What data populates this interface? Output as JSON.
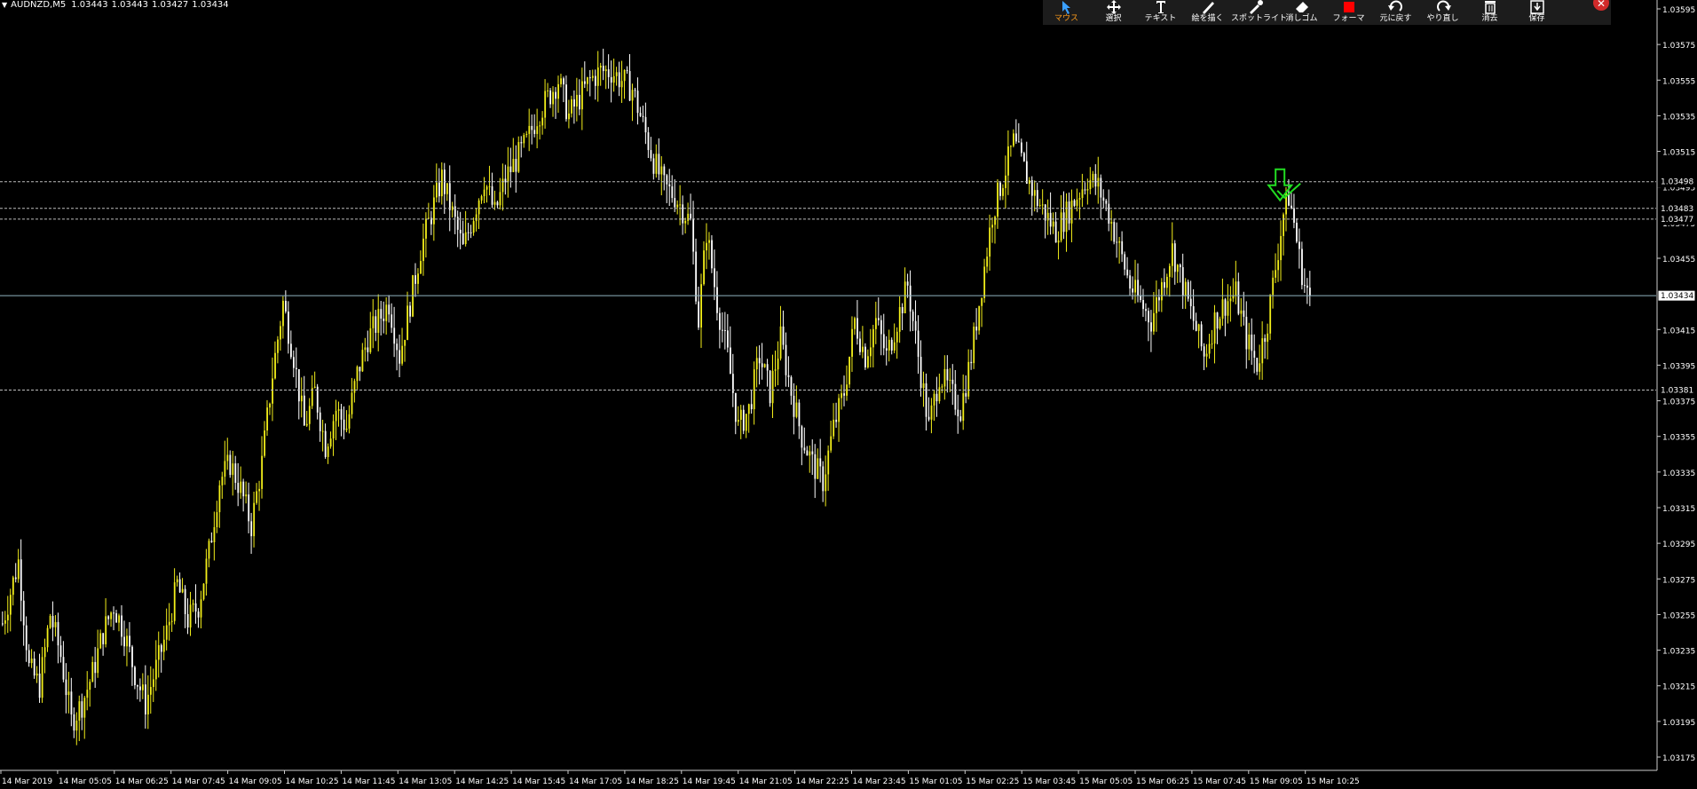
{
  "symbol": {
    "name": "AUDNZD,M5",
    "open": "1.03443",
    "high": "1.03443",
    "low": "1.03427",
    "close": "1.03434"
  },
  "toolbar": {
    "items": [
      {
        "label": "マウス",
        "icon": "cursor-icon",
        "active": true
      },
      {
        "label": "選択",
        "icon": "move-icon",
        "active": false
      },
      {
        "label": "テキスト",
        "icon": "text-icon",
        "active": false
      },
      {
        "label": "絵を描く",
        "icon": "pen-icon",
        "active": false
      },
      {
        "label": "スポットライト",
        "icon": "spotlight-icon",
        "active": false
      },
      {
        "label": "消しゴム",
        "icon": "eraser-icon",
        "active": false
      },
      {
        "label": "フォーマ",
        "icon": "color-swatch-icon",
        "active": false
      },
      {
        "label": "元に戻す",
        "icon": "undo-icon",
        "active": false
      },
      {
        "label": "やり直し",
        "icon": "redo-icon",
        "active": false
      },
      {
        "label": "消去",
        "icon": "trash-icon",
        "active": false
      },
      {
        "label": "保存",
        "icon": "save-icon",
        "active": false
      }
    ],
    "close_icon": "close-icon",
    "swatch_color": "#ff0000"
  },
  "colors": {
    "background": "#000000",
    "bull_candle": "#f2ee1a",
    "bear_candle": "#ffffff",
    "grid_line": "#bbbbbb",
    "bid_line": "#8fb3c0",
    "annotation": "#22dd22"
  },
  "chart_data": {
    "type": "candlestick",
    "y_tick_labels": [
      "1.03595",
      "1.03575",
      "1.03555",
      "1.03535",
      "1.03515",
      "1.03495",
      "1.03475",
      "1.03455",
      "1.03435",
      "1.03415",
      "1.03395",
      "1.03375",
      "1.03355",
      "1.03335",
      "1.03315",
      "1.03295",
      "1.03275",
      "1.03255",
      "1.03235",
      "1.03215",
      "1.03195",
      "1.03175"
    ],
    "x_tick_labels": [
      "14 Mar 2019",
      "14 Mar 05:05",
      "14 Mar 06:25",
      "14 Mar 07:45",
      "14 Mar 09:05",
      "14 Mar 10:25",
      "14 Mar 11:45",
      "14 Mar 13:05",
      "14 Mar 14:25",
      "14 Mar 15:45",
      "14 Mar 17:05",
      "14 Mar 18:25",
      "14 Mar 19:45",
      "14 Mar 21:05",
      "14 Mar 22:25",
      "14 Mar 23:45",
      "15 Mar 01:05",
      "15 Mar 02:25",
      "15 Mar 03:45",
      "15 Mar 05:05",
      "15 Mar 06:25",
      "15 Mar 07:45",
      "15 Mar 09:05",
      "15 Mar 10:25"
    ],
    "ylim": [
      1.0317,
      1.036
    ],
    "bid_price": 1.03434,
    "price_levels": [
      {
        "label": "1.03498",
        "value": 1.03498
      },
      {
        "label": "1.03483",
        "value": 1.03483
      },
      {
        "label": "1.03477",
        "value": 1.03477
      },
      {
        "label": "1.03381",
        "value": 1.03381
      }
    ],
    "bid_label": "1.03434",
    "close_path": [
      [
        0,
        1.0325
      ],
      [
        6,
        1.03285
      ],
      [
        10,
        1.03225
      ],
      [
        14,
        1.03215
      ],
      [
        18,
        1.03255
      ],
      [
        22,
        1.03232
      ],
      [
        26,
        1.03195
      ],
      [
        30,
        1.03205
      ],
      [
        34,
        1.03222
      ],
      [
        38,
        1.03245
      ],
      [
        42,
        1.0326
      ],
      [
        46,
        1.03245
      ],
      [
        50,
        1.03222
      ],
      [
        54,
        1.03205
      ],
      [
        58,
        1.03225
      ],
      [
        62,
        1.03245
      ],
      [
        66,
        1.03272
      ],
      [
        70,
        1.03252
      ],
      [
        74,
        1.0326
      ],
      [
        78,
        1.0329
      ],
      [
        82,
        1.0333
      ],
      [
        86,
        1.0334
      ],
      [
        90,
        1.03325
      ],
      [
        94,
        1.03305
      ],
      [
        98,
        1.0334
      ],
      [
        102,
        1.0339
      ],
      [
        106,
        1.0343
      ],
      [
        110,
        1.034
      ],
      [
        114,
        1.0336
      ],
      [
        118,
        1.0338
      ],
      [
        122,
        1.0335
      ],
      [
        126,
        1.0337
      ],
      [
        130,
        1.0336
      ],
      [
        134,
        1.0339
      ],
      [
        138,
        1.0341
      ],
      [
        142,
        1.0342
      ],
      [
        146,
        1.0343
      ],
      [
        150,
        1.034
      ],
      [
        154,
        1.0343
      ],
      [
        158,
        1.0346
      ],
      [
        162,
        1.0348
      ],
      [
        166,
        1.035
      ],
      [
        170,
        1.0348
      ],
      [
        174,
        1.0346
      ],
      [
        178,
        1.0348
      ],
      [
        182,
        1.035
      ],
      [
        186,
        1.0348
      ],
      [
        190,
        1.035
      ],
      [
        194,
        1.0351
      ],
      [
        198,
        1.0352
      ],
      [
        202,
        1.03535
      ],
      [
        206,
        1.03545
      ],
      [
        210,
        1.03555
      ],
      [
        214,
        1.03535
      ],
      [
        218,
        1.03545
      ],
      [
        222,
        1.03555
      ],
      [
        226,
        1.0356
      ],
      [
        230,
        1.0356
      ],
      [
        234,
        1.03555
      ],
      [
        238,
        1.0355
      ],
      [
        242,
        1.0353
      ],
      [
        246,
        1.0351
      ],
      [
        250,
        1.03495
      ],
      [
        254,
        1.0349
      ],
      [
        258,
        1.0348
      ],
      [
        260,
        1.03475
      ],
      [
        263,
        1.0342
      ],
      [
        266,
        1.0347
      ],
      [
        270,
        1.0343
      ],
      [
        274,
        1.034
      ],
      [
        278,
        1.0336
      ],
      [
        282,
        1.0337
      ],
      [
        286,
        1.034
      ],
      [
        290,
        1.0338
      ],
      [
        294,
        1.0341
      ],
      [
        298,
        1.0338
      ],
      [
        302,
        1.03355
      ],
      [
        306,
        1.0334
      ],
      [
        310,
        1.0333
      ],
      [
        314,
        1.0336
      ],
      [
        318,
        1.0338
      ],
      [
        322,
        1.0342
      ],
      [
        326,
        1.034
      ],
      [
        330,
        1.0342
      ],
      [
        334,
        1.034
      ],
      [
        338,
        1.0342
      ],
      [
        342,
        1.0344
      ],
      [
        346,
        1.034
      ],
      [
        350,
        1.0336
      ],
      [
        354,
        1.0339
      ],
      [
        358,
        1.0338
      ],
      [
        362,
        1.0337
      ],
      [
        366,
        1.034
      ],
      [
        370,
        1.0344
      ],
      [
        374,
        1.0348
      ],
      [
        378,
        1.035
      ],
      [
        382,
        1.0352
      ],
      [
        386,
        1.03505
      ],
      [
        390,
        1.0349
      ],
      [
        394,
        1.0348
      ],
      [
        398,
        1.0347
      ],
      [
        402,
        1.0348
      ],
      [
        406,
        1.0349
      ],
      [
        410,
        1.035
      ],
      [
        414,
        1.03495
      ],
      [
        418,
        1.0348
      ],
      [
        422,
        1.0346
      ],
      [
        426,
        1.0344
      ],
      [
        430,
        1.0343
      ],
      [
        434,
        1.0342
      ],
      [
        438,
        1.0344
      ],
      [
        442,
        1.0346
      ],
      [
        446,
        1.0344
      ],
      [
        450,
        1.0342
      ],
      [
        454,
        1.034
      ],
      [
        458,
        1.0342
      ],
      [
        462,
        1.0343
      ],
      [
        466,
        1.03435
      ],
      [
        470,
        1.0341
      ],
      [
        474,
        1.03395
      ],
      [
        478,
        1.0342
      ],
      [
        482,
        1.0346
      ],
      [
        484,
        1.0348
      ],
      [
        486,
        1.0349
      ],
      [
        488,
        1.03475
      ],
      [
        490,
        1.03455
      ],
      [
        492,
        1.0344
      ],
      [
        494,
        1.03434
      ]
    ],
    "bars": 495
  }
}
